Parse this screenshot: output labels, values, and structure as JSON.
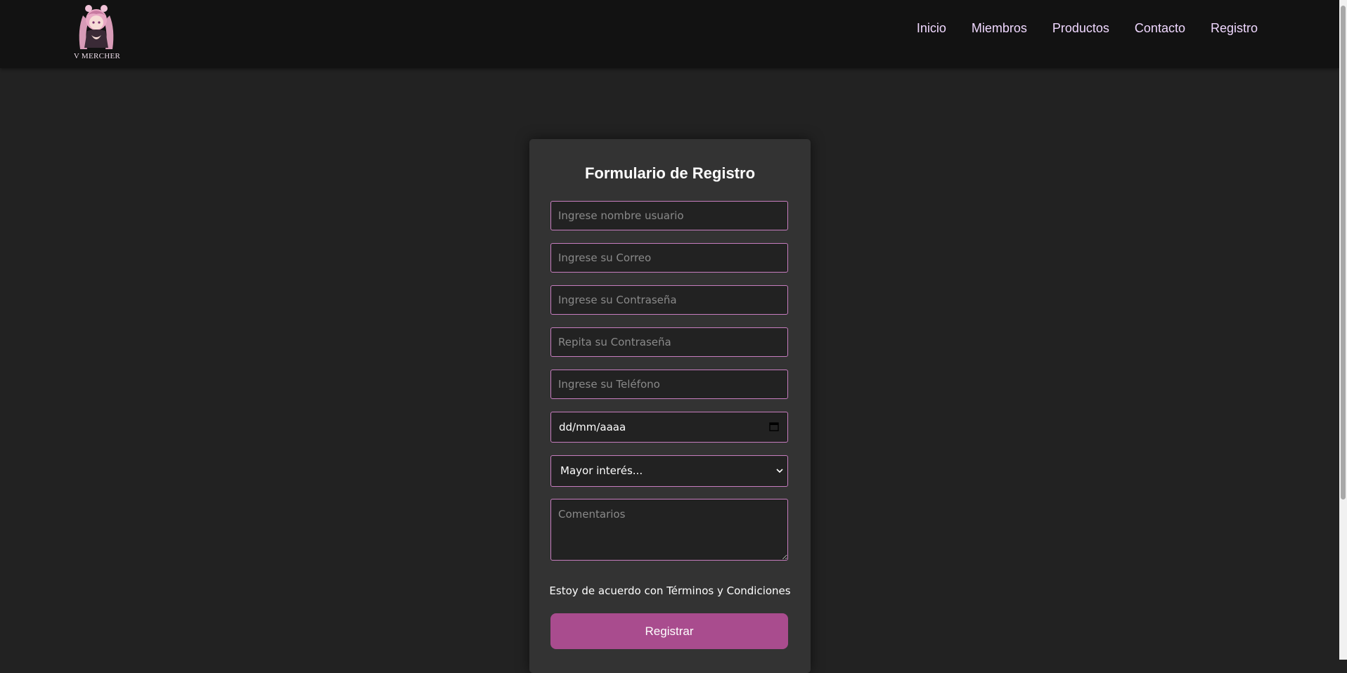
{
  "header": {
    "logo_text": "V MERCHER",
    "nav": [
      {
        "label": "Inicio"
      },
      {
        "label": "Miembros"
      },
      {
        "label": "Productos"
      },
      {
        "label": "Contacto"
      },
      {
        "label": "Registro"
      }
    ]
  },
  "form": {
    "title": "Formulario de Registro",
    "username_placeholder": "Ingrese nombre usuario",
    "email_placeholder": "Ingrese su Correo",
    "password_placeholder": "Ingrese su Contraseña",
    "repeat_password_placeholder": "Repita su Contraseña",
    "phone_placeholder": "Ingrese su Teléfono",
    "date_value": "dd/mm/aaaa",
    "interest_selected": "Mayor interés...",
    "comments_placeholder": "Comentarios",
    "terms_text": "Estoy de acuerdo con Términos y Condiciones",
    "submit_label": "Registrar"
  },
  "colors": {
    "page_bg": "#222222",
    "header_bg": "#121212",
    "card_bg": "#333333",
    "field_border": "#c77dbf",
    "nav_text": "#f0d8ff",
    "button_bg": "#a94c8e"
  },
  "icons": {
    "logo": "anime-girl-logo",
    "date": "calendar-icon",
    "select": "chevron-down-icon"
  }
}
